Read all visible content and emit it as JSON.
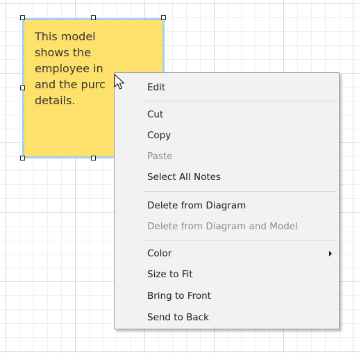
{
  "note": {
    "text": "This model\nshows the\nemployee in\nand the purc\ndetails."
  },
  "context_menu": {
    "items": [
      {
        "label": "Edit",
        "enabled": true
      },
      {
        "label": "Cut",
        "enabled": true
      },
      {
        "label": "Copy",
        "enabled": true
      },
      {
        "label": "Paste",
        "enabled": false
      },
      {
        "label": "Select All Notes",
        "enabled": true
      },
      {
        "label": "Delete from Diagram",
        "enabled": true
      },
      {
        "label": "Delete from Diagram and Model",
        "enabled": false
      },
      {
        "label": "Color",
        "enabled": true,
        "has_submenu": true
      },
      {
        "label": "Size to Fit",
        "enabled": true
      },
      {
        "label": "Bring to Front",
        "enabled": true
      },
      {
        "label": "Send to Back",
        "enabled": true
      }
    ]
  },
  "colors": {
    "note_fill": "#fde16a",
    "selection_border": "#a8cdf2",
    "menu_background": "#f2f2f2"
  },
  "icons": [
    "mouse-pointer-icon",
    "chevron-right-icon"
  ]
}
